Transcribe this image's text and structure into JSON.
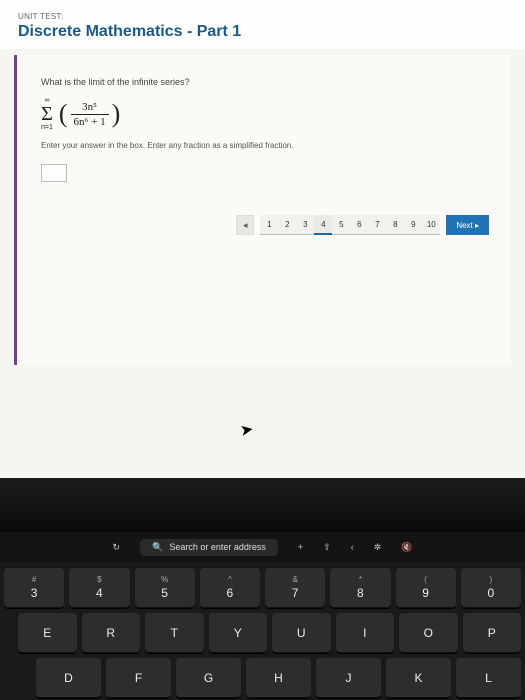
{
  "header": {
    "unit_label": "UNIT TEST:",
    "title": "Discrete Mathematics - Part 1"
  },
  "question": {
    "prompt": "What is the limit of the infinite series?",
    "sigma_upper": "∞",
    "sigma_lower": "n=1",
    "frac_numerator": "3n⁵",
    "frac_denominator": "6n⁶ + 1",
    "instruction": "Enter your answer in the box. Enter any fraction as a simplified fraction.",
    "answer_value": ""
  },
  "pager": {
    "prev_symbol": "◂",
    "numbers": [
      "1",
      "2",
      "3",
      "4",
      "5",
      "6",
      "7",
      "8",
      "9",
      "10"
    ],
    "current": "4",
    "next_label": "Next ▸"
  },
  "touchbar": {
    "refresh": "↻",
    "search_icon": "🔍",
    "search_text": "Search or enter address",
    "plus": "+",
    "share": "⇧",
    "back": "‹",
    "bright": "✲",
    "mute": "🔇"
  },
  "keyboard": {
    "row1": [
      {
        "u": "#",
        "l": "3"
      },
      {
        "u": "$",
        "l": "4"
      },
      {
        "u": "%",
        "l": "5"
      },
      {
        "u": "^",
        "l": "6"
      },
      {
        "u": "&",
        "l": "7"
      },
      {
        "u": "*",
        "l": "8"
      },
      {
        "u": "(",
        "l": "9"
      },
      {
        "u": ")",
        "l": "0"
      }
    ],
    "row2": [
      "E",
      "R",
      "T",
      "Y",
      "U",
      "I",
      "O",
      "P"
    ],
    "row3": [
      "D",
      "F",
      "G",
      "H",
      "J",
      "K",
      "L"
    ]
  }
}
